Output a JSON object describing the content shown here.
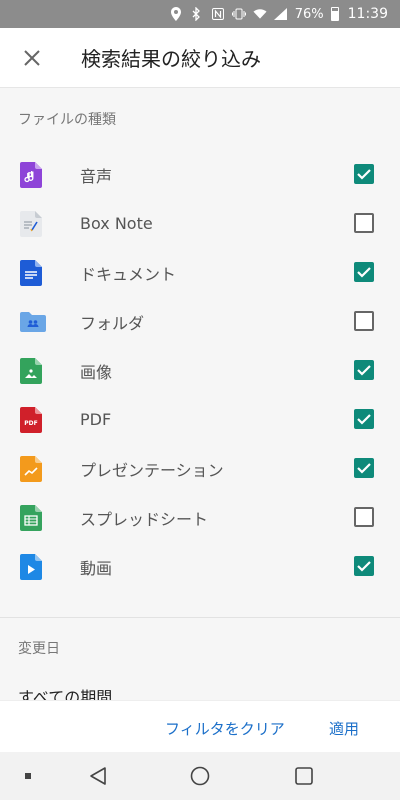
{
  "status_bar": {
    "battery": "76%",
    "time": "11:39"
  },
  "header": {
    "title": "検索結果の絞り込み",
    "close_icon": "close-icon"
  },
  "sections": {
    "file_type": "ファイルの種類",
    "modified_date": "変更日"
  },
  "file_types": [
    {
      "label": "音声",
      "icon": "audio-file-icon",
      "checked": true,
      "color": "#8e44d8"
    },
    {
      "label": "Box Note",
      "icon": "box-note-icon",
      "checked": false,
      "color": "#9aa3ad"
    },
    {
      "label": "ドキュメント",
      "icon": "document-icon",
      "checked": true,
      "color": "#1e5cd6"
    },
    {
      "label": "フォルダ",
      "icon": "folder-icon",
      "checked": false,
      "color": "#6aa6e6"
    },
    {
      "label": "画像",
      "icon": "image-icon",
      "checked": true,
      "color": "#33a35c"
    },
    {
      "label": "PDF",
      "icon": "pdf-icon",
      "checked": true,
      "color": "#d0202a"
    },
    {
      "label": "プレゼンテーション",
      "icon": "presentation-icon",
      "checked": true,
      "color": "#f39a1c"
    },
    {
      "label": "スプレッドシート",
      "icon": "spreadsheet-icon",
      "checked": false,
      "color": "#35a35e"
    },
    {
      "label": "動画",
      "icon": "video-icon",
      "checked": true,
      "color": "#1e88e5"
    }
  ],
  "period": {
    "value": "すべての期間"
  },
  "actions": {
    "clear": "フィルタをクリア",
    "apply": "適用"
  },
  "colors": {
    "checkbox_on": "#0e8a7a",
    "action_text": "#1b6fc9"
  }
}
